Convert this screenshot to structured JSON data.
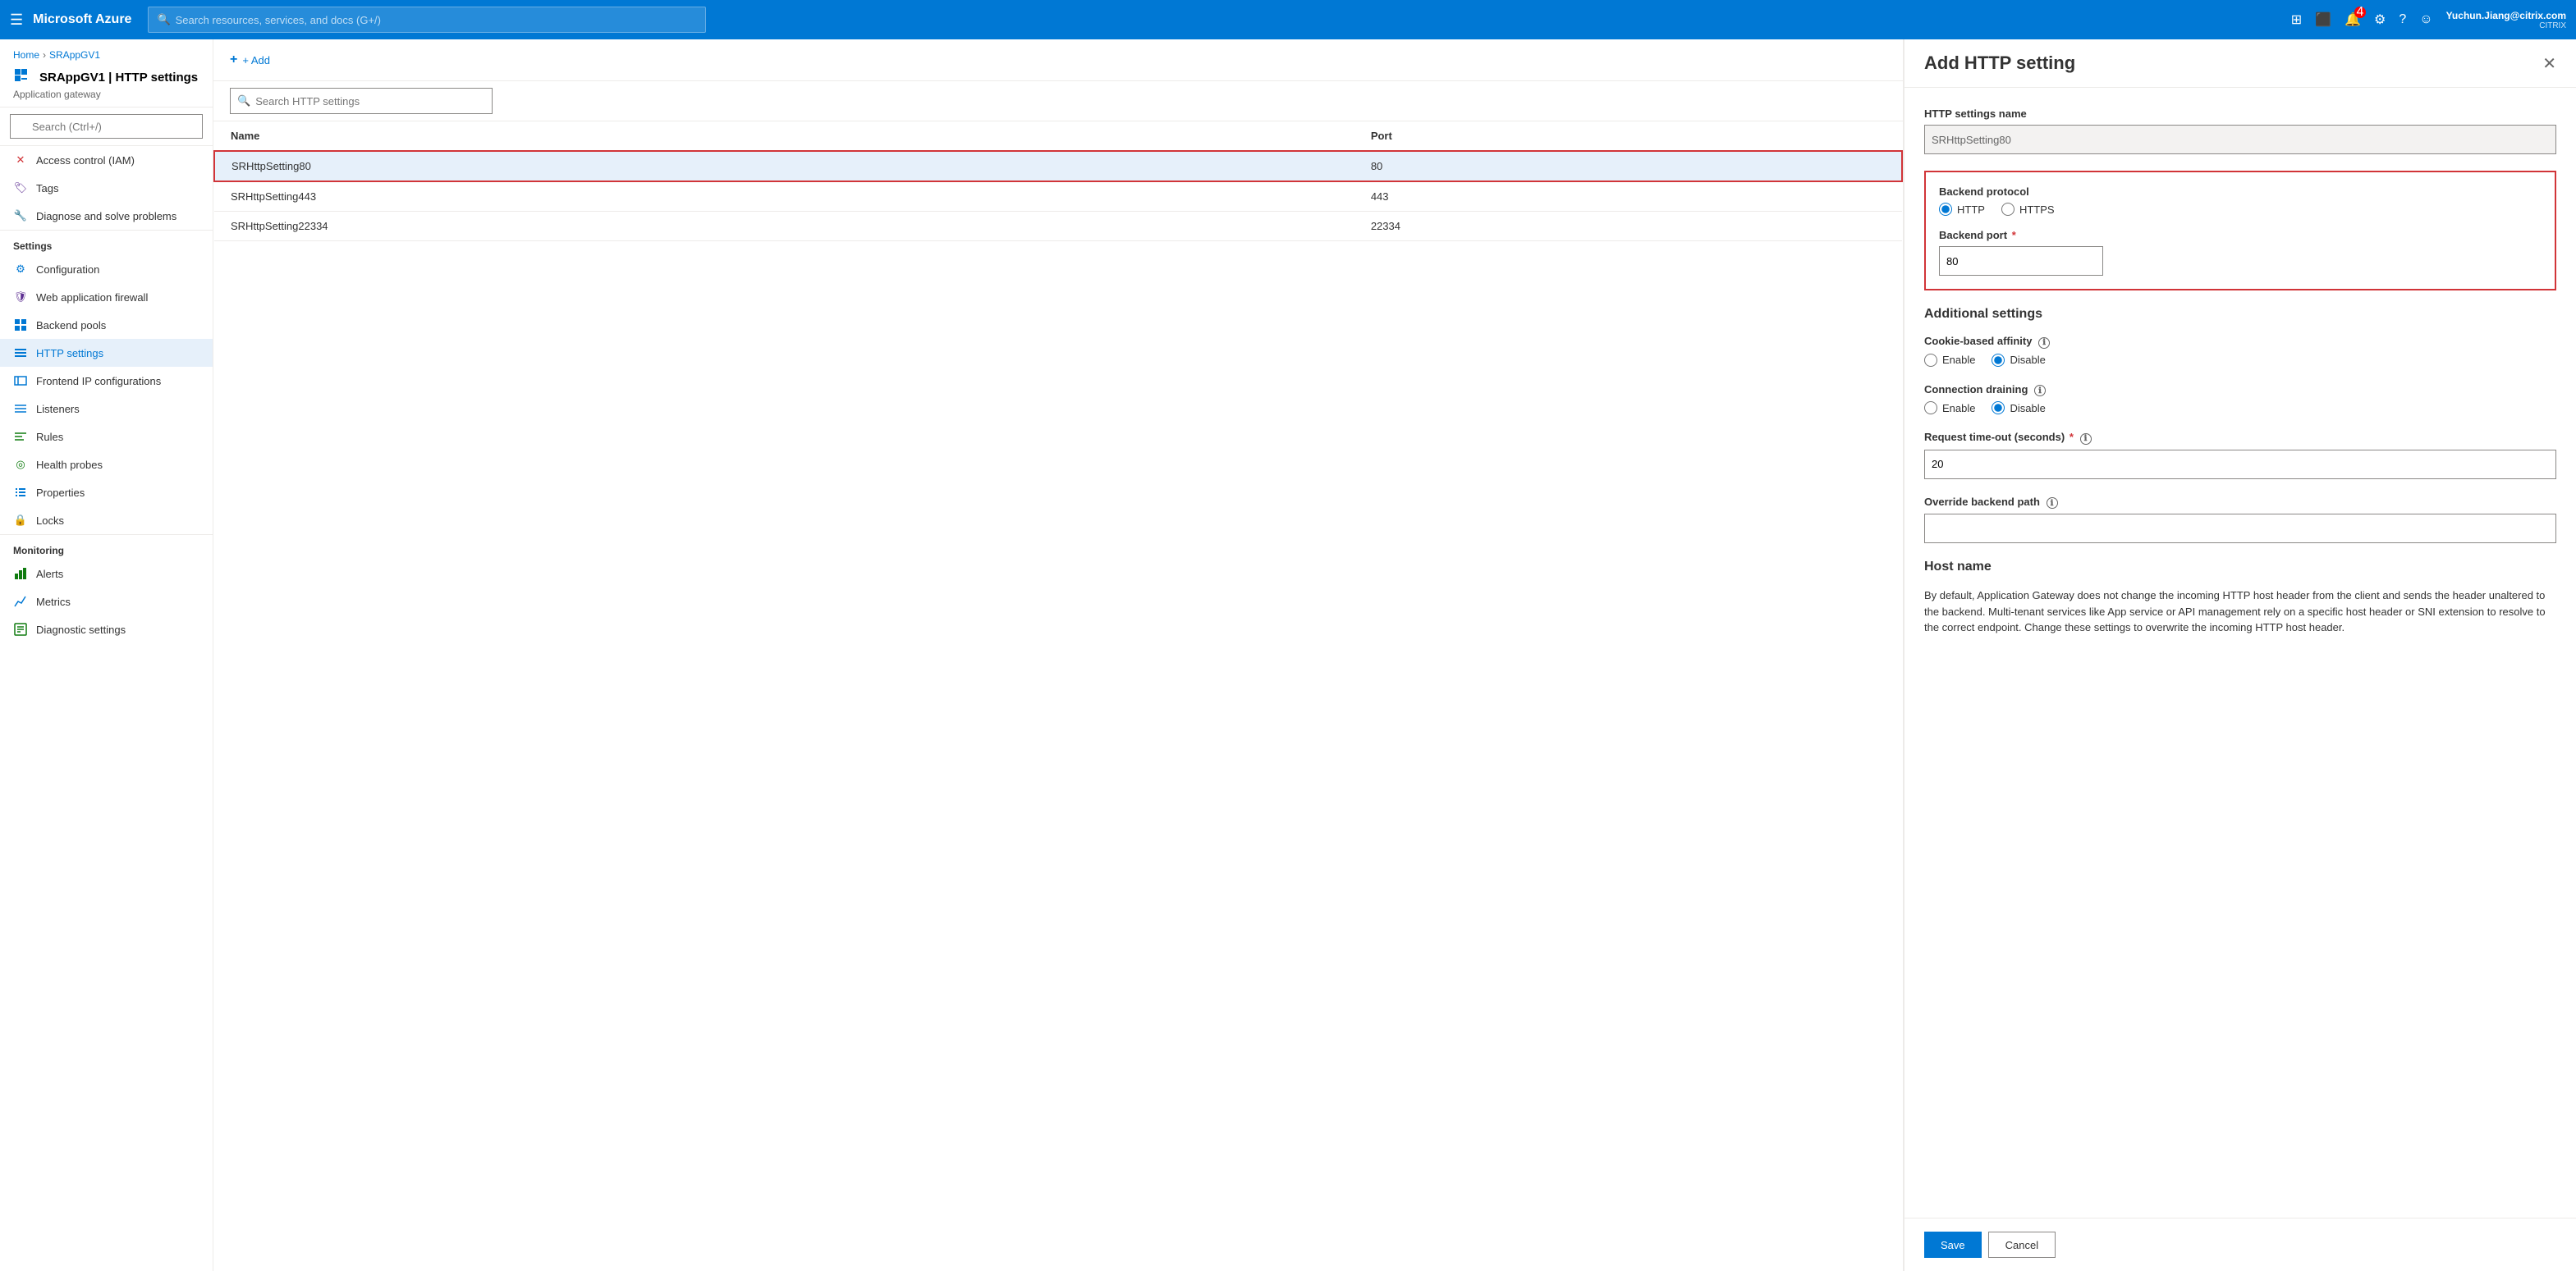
{
  "topnav": {
    "hamburger": "☰",
    "brand": "Microsoft Azure",
    "search_placeholder": "Search resources, services, and docs (G+/)",
    "notification_count": "4",
    "user_name": "Yuchun.Jiang@citrix.com",
    "user_org": "CITRIX"
  },
  "breadcrumb": {
    "home": "Home",
    "resource": "SRAppGV1"
  },
  "sidebar": {
    "title": "SRAppGV1 | HTTP settings",
    "subtitle": "Application gateway",
    "search_placeholder": "Search (Ctrl+/)",
    "nav_items": [
      {
        "id": "access-control",
        "label": "Access control (IAM)",
        "icon": "🔒"
      },
      {
        "id": "tags",
        "label": "Tags",
        "icon": "🏷"
      },
      {
        "id": "diagnose",
        "label": "Diagnose and solve problems",
        "icon": "🔧"
      }
    ],
    "settings_section": "Settings",
    "settings_items": [
      {
        "id": "configuration",
        "label": "Configuration",
        "icon": "⚙"
      },
      {
        "id": "waf",
        "label": "Web application firewall",
        "icon": "🛡"
      },
      {
        "id": "backend-pools",
        "label": "Backend pools",
        "icon": "⊞"
      },
      {
        "id": "http-settings",
        "label": "HTTP settings",
        "icon": "≡",
        "active": true
      },
      {
        "id": "frontend-ip",
        "label": "Frontend IP configurations",
        "icon": "⊟"
      },
      {
        "id": "listeners",
        "label": "Listeners",
        "icon": "≡"
      },
      {
        "id": "rules",
        "label": "Rules",
        "icon": "≡"
      },
      {
        "id": "health-probes",
        "label": "Health probes",
        "icon": "◎"
      },
      {
        "id": "properties",
        "label": "Properties",
        "icon": "|||"
      },
      {
        "id": "locks",
        "label": "Locks",
        "icon": "🔒"
      }
    ],
    "monitoring_section": "Monitoring",
    "monitoring_items": [
      {
        "id": "alerts",
        "label": "Alerts",
        "icon": "🔔"
      },
      {
        "id": "metrics",
        "label": "Metrics",
        "icon": "📊"
      },
      {
        "id": "diagnostic",
        "label": "Diagnostic settings",
        "icon": "📋"
      }
    ]
  },
  "http_list": {
    "toolbar_add": "+ Add",
    "search_placeholder": "Search HTTP settings",
    "columns": [
      {
        "id": "name",
        "label": "Name"
      },
      {
        "id": "port",
        "label": "Port"
      }
    ],
    "rows": [
      {
        "name": "SRHttpSetting80",
        "port": "80",
        "selected": true
      },
      {
        "name": "SRHttpSetting443",
        "port": "443",
        "selected": false
      },
      {
        "name": "SRHttpSetting22334",
        "port": "22334",
        "selected": false
      }
    ]
  },
  "add_http": {
    "title": "Add HTTP setting",
    "close_icon": "✕",
    "http_settings_name_label": "HTTP settings name",
    "http_settings_name_value": "SRHttpSetting80",
    "backend_protocol_label": "Backend protocol",
    "backend_protocol_options": [
      {
        "id": "http",
        "label": "HTTP",
        "selected": true
      },
      {
        "id": "https",
        "label": "HTTPS",
        "selected": false
      }
    ],
    "backend_port_label": "Backend port",
    "backend_port_required": "*",
    "backend_port_value": "80",
    "additional_settings_label": "Additional settings",
    "cookie_affinity_label": "Cookie-based affinity",
    "cookie_affinity_info": "ℹ",
    "cookie_affinity_options": [
      {
        "id": "enable",
        "label": "Enable",
        "selected": false
      },
      {
        "id": "disable",
        "label": "Disable",
        "selected": true
      }
    ],
    "connection_draining_label": "Connection draining",
    "connection_draining_info": "ℹ",
    "connection_draining_options": [
      {
        "id": "enable",
        "label": "Enable",
        "selected": false
      },
      {
        "id": "disable",
        "label": "Disable",
        "selected": true
      }
    ],
    "request_timeout_label": "Request time-out (seconds)",
    "request_timeout_required": "*",
    "request_timeout_info": "ℹ",
    "request_timeout_value": "20",
    "override_backend_path_label": "Override backend path",
    "override_backend_path_info": "ℹ",
    "override_backend_path_value": "",
    "host_name_label": "Host name",
    "host_name_desc": "By default, Application Gateway does not change the incoming HTTP host header from the client and sends the header unaltered to the backend. Multi-tenant services like App service or API management rely on a specific host header or SNI extension to resolve to the correct endpoint. Change these settings to overwrite the incoming HTTP host header.",
    "save_label": "Save",
    "cancel_label": "Cancel"
  }
}
